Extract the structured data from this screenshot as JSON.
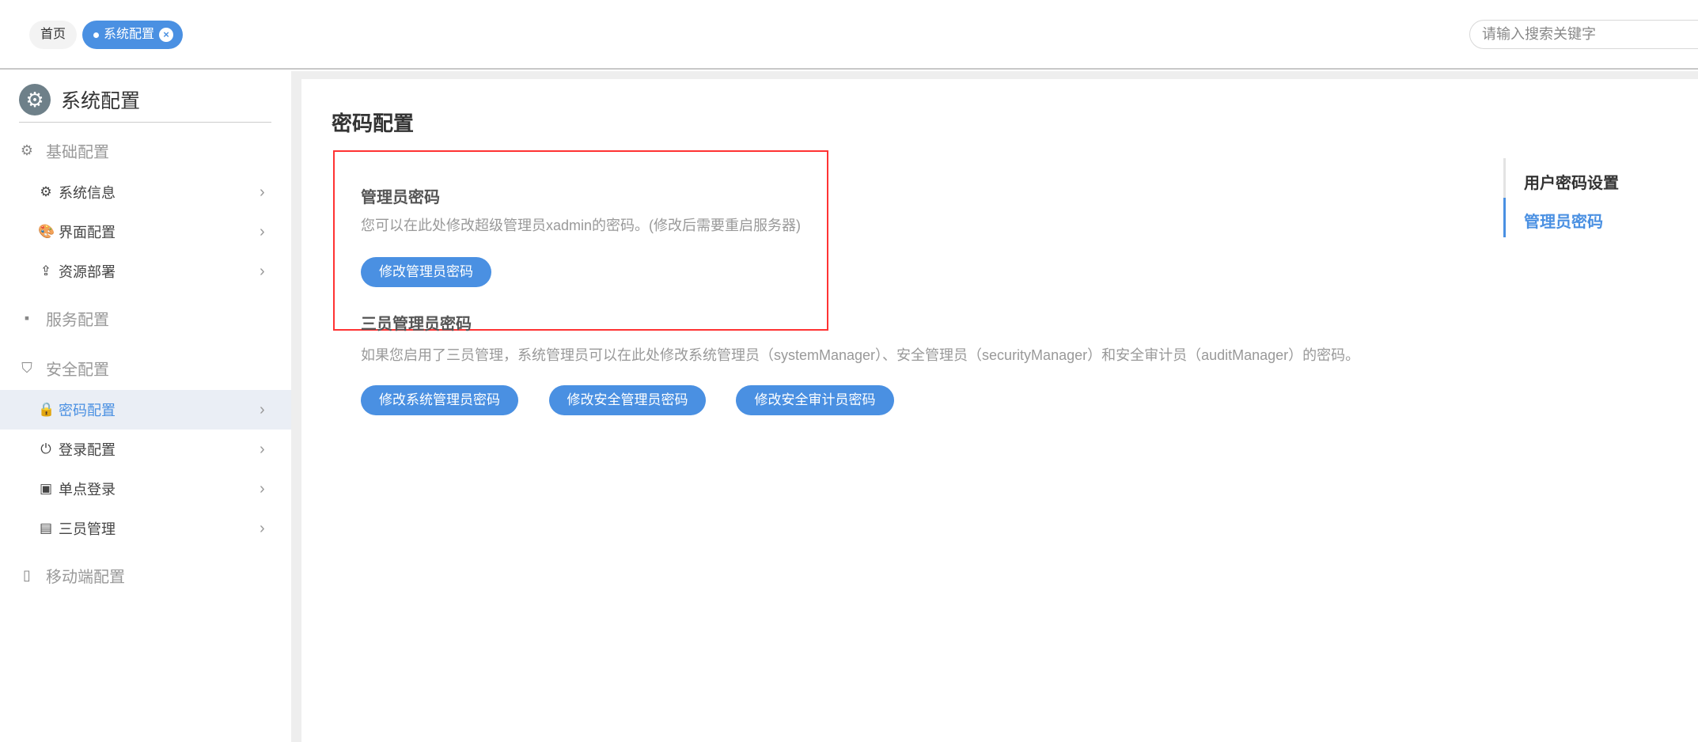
{
  "tabs": [
    {
      "label": "首页"
    },
    {
      "label": "系统配置",
      "active": true
    }
  ],
  "search": {
    "placeholder": "请输入搜索关键字"
  },
  "sidebar": {
    "title": "系统配置",
    "groups": [
      {
        "label": "基础配置",
        "icon": "gear-icon",
        "items": [
          {
            "label": "系统信息",
            "icon": "gear-icon"
          },
          {
            "label": "界面配置",
            "icon": "palette-icon"
          },
          {
            "label": "资源部署",
            "icon": "upload-icon"
          }
        ]
      },
      {
        "label": "服务配置",
        "icon": "server-icon",
        "items": []
      },
      {
        "label": "安全配置",
        "icon": "shield-icon",
        "items": [
          {
            "label": "密码配置",
            "icon": "lock-icon",
            "selected": true
          },
          {
            "label": "登录配置",
            "icon": "login-icon"
          },
          {
            "label": "单点登录",
            "icon": "contact-card-icon"
          },
          {
            "label": "三员管理",
            "icon": "document-icon"
          }
        ]
      },
      {
        "label": "移动端配置",
        "icon": "mobile-icon",
        "items": []
      }
    ]
  },
  "main": {
    "title": "密码配置",
    "admin": {
      "heading": "管理员密码",
      "desc": "您可以在此处修改超级管理员xadmin的密码。(修改后需要重启服务器)",
      "button": "修改管理员密码"
    },
    "three": {
      "heading": "三员管理员密码",
      "desc": "如果您启用了三员管理，系统管理员可以在此处修改系统管理员（systemManager）、安全管理员（securityManager）和安全审计员（auditManager）的密码。",
      "buttons": [
        "修改系统管理员密码",
        "修改安全管理员密码",
        "修改安全审计员密码"
      ]
    }
  },
  "anchor": {
    "title": "用户密码设置",
    "items": [
      {
        "label": "管理员密码",
        "active": true
      }
    ]
  },
  "colors": {
    "accent": "#4a90e2",
    "highlight_box": "#ff3333"
  }
}
